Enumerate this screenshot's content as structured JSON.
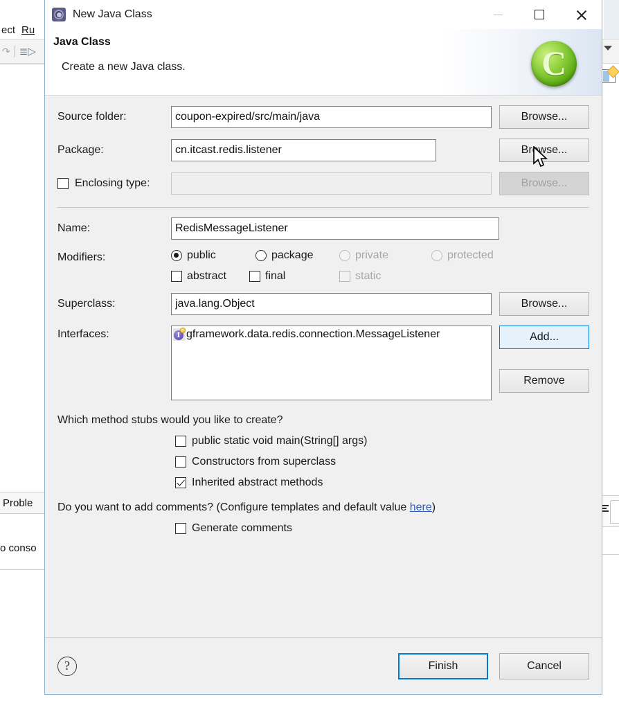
{
  "background": {
    "menu_project_fragment": "ect",
    "menu_run_fragment": "Ru",
    "problems_tab": "Proble",
    "console_text": "o conso"
  },
  "dialog": {
    "titlebar": {
      "icon": "eclipse-wizard-icon",
      "title": "New Java Class",
      "minimize_label": "–",
      "maximize_label": "□",
      "close_label": "✕"
    },
    "banner": {
      "title": "Java Class",
      "description": "Create a new Java class.",
      "icon": "green-class-circle-icon",
      "icon_letter": "C"
    },
    "fields": {
      "source_folder": {
        "label": "Source folder:",
        "value": "coupon-expired/src/main/java",
        "browse_label": "Browse..."
      },
      "package": {
        "label": "Package:",
        "value": "cn.itcast.redis.listener",
        "browse_label": "Browse..."
      },
      "enclosing_type": {
        "label": "Enclosing type:",
        "value": "",
        "checked": false,
        "enabled": false,
        "browse_label": "Browse..."
      },
      "name": {
        "label": "Name:",
        "value": "RedisMessageListener"
      },
      "superclass": {
        "label": "Superclass:",
        "value": "java.lang.Object",
        "browse_label": "Browse..."
      },
      "interfaces": {
        "label": "Interfaces:",
        "items": [
          {
            "icon": "interface-icon",
            "text": "gframework.data.redis.connection.MessageListener"
          }
        ],
        "add_label": "Add...",
        "remove_label": "Remove"
      }
    },
    "modifiers": {
      "label": "Modifiers:",
      "access": [
        {
          "label": "public",
          "selected": true,
          "enabled": true
        },
        {
          "label": "package",
          "selected": false,
          "enabled": true
        },
        {
          "label": "private",
          "selected": false,
          "enabled": false
        },
        {
          "label": "protected",
          "selected": false,
          "enabled": false
        }
      ],
      "flags": [
        {
          "label": "abstract",
          "checked": false,
          "enabled": true
        },
        {
          "label": "final",
          "checked": false,
          "enabled": true
        },
        {
          "label": "static",
          "checked": false,
          "enabled": false
        }
      ]
    },
    "method_stubs": {
      "question": "Which method stubs would you like to create?",
      "options": [
        {
          "label": "public static void main(String[] args)",
          "checked": false
        },
        {
          "label": "Constructors from superclass",
          "checked": false
        },
        {
          "label": "Inherited abstract methods",
          "checked": true
        }
      ]
    },
    "comments": {
      "question_prefix": "Do you want to add comments? (Configure templates and default value ",
      "link_label": "here",
      "question_suffix": ")",
      "generate_label": "Generate comments",
      "generate_checked": false
    },
    "footer": {
      "help_label": "?",
      "finish_label": "Finish",
      "cancel_label": "Cancel"
    }
  },
  "colors": {
    "accent": "#0078d7",
    "dialog_bg": "#f0f0f0",
    "link": "#2e5bb8",
    "banner_icon_green": "#5fae16"
  }
}
